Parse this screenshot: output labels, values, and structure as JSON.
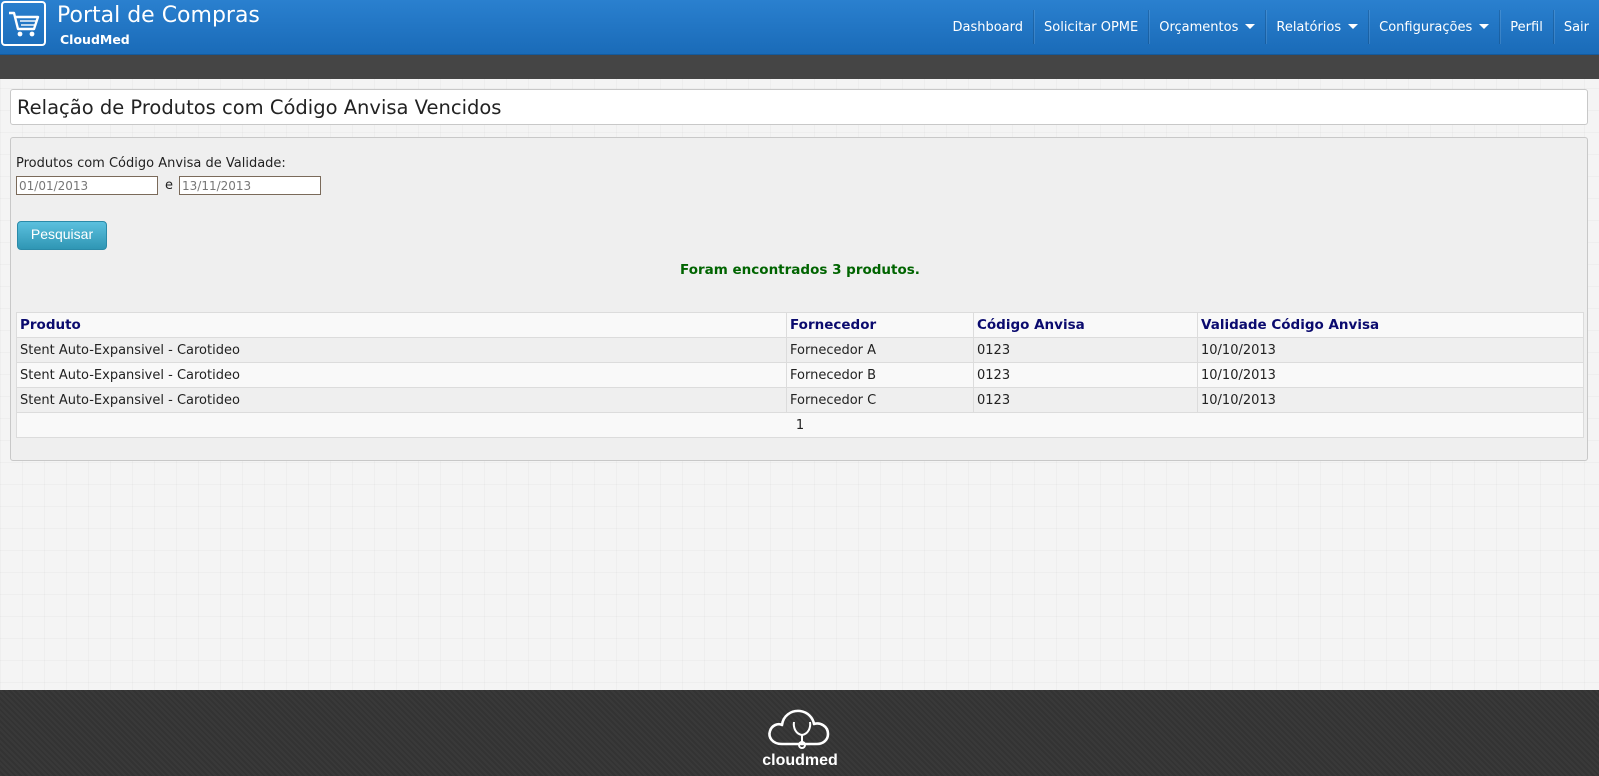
{
  "header": {
    "title": "Portal de Compras",
    "subtitle": "CloudMed",
    "logo_icon": "shopping-cart-icon",
    "nav": [
      {
        "label": "Dashboard",
        "dropdown": false
      },
      {
        "label": "Solicitar OPME",
        "dropdown": false
      },
      {
        "label": "Orçamentos",
        "dropdown": true
      },
      {
        "label": "Relatórios",
        "dropdown": true
      },
      {
        "label": "Configurações",
        "dropdown": true
      },
      {
        "label": "Perfil",
        "dropdown": false
      },
      {
        "label": "Sair",
        "dropdown": false
      }
    ]
  },
  "page": {
    "title": "Relação de Produtos com Código Anvisa Vencidos"
  },
  "filter": {
    "label": "Produtos com Código Anvisa de Validade:",
    "start_date": "01/01/2013",
    "connector": "e",
    "end_date": "13/11/2013",
    "search_button": "Pesquisar"
  },
  "results": {
    "message": "Foram encontrados 3 produtos.",
    "columns": [
      "Produto",
      "Fornecedor",
      "Código Anvisa",
      "Validade Código Anvisa"
    ],
    "rows": [
      [
        "Stent Auto-Expansivel - Carotideo",
        "Fornecedor A",
        "0123",
        "10/10/2013"
      ],
      [
        "Stent Auto-Expansivel - Carotideo",
        "Fornecedor B",
        "0123",
        "10/10/2013"
      ],
      [
        "Stent Auto-Expansivel - Carotideo",
        "Fornecedor C",
        "0123",
        "10/10/2013"
      ]
    ],
    "pager": "1"
  },
  "footer": {
    "logo_text": "cloudmed",
    "logo_icon": "cloud-stethoscope-icon"
  },
  "colors": {
    "navbar": "#1f74c2",
    "subbar": "#454545",
    "result_message": "#006400",
    "table_header": "#0a0a6e",
    "button": "#3aa6c9",
    "footer": "#333333"
  }
}
